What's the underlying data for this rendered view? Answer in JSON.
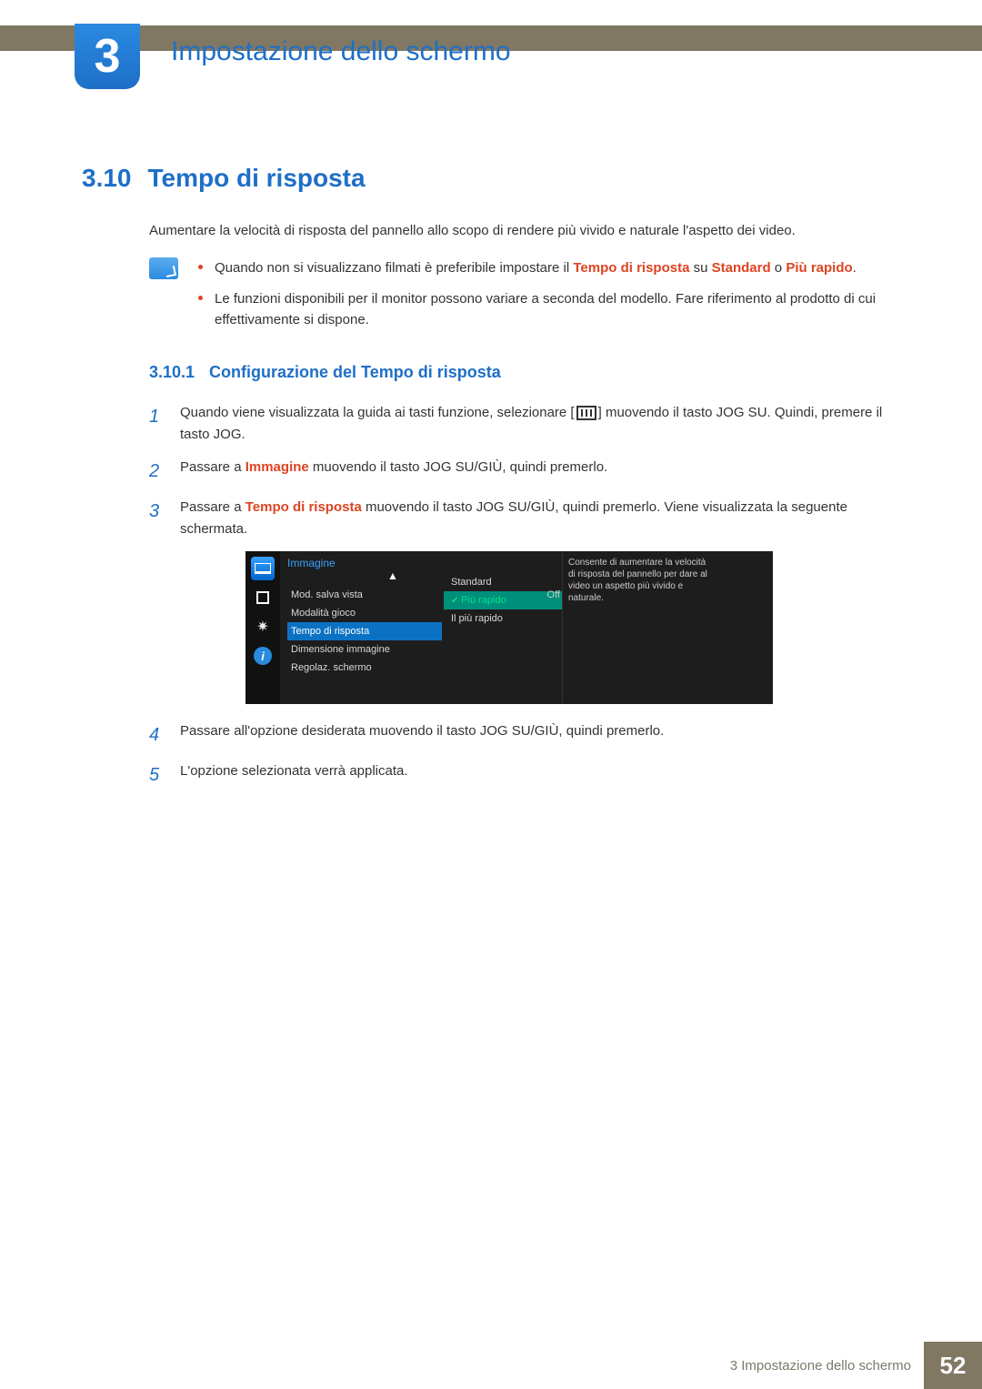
{
  "chapter": {
    "number": "3",
    "title": "Impostazione dello schermo"
  },
  "section": {
    "number": "3.10",
    "title": "Tempo di risposta"
  },
  "intro": "Aumentare la velocità di risposta del pannello allo scopo di rendere più vivido e naturale l'aspetto dei video.",
  "notes": {
    "items": [
      {
        "pre": "Quando non si visualizzano filmati è preferibile impostare il ",
        "b1": "Tempo di risposta",
        "mid": " su ",
        "b2": "Standard",
        "or": " o ",
        "b3": "Più rapido",
        "end": "."
      },
      "Le funzioni disponibili per il monitor possono variare a seconda del modello. Fare riferimento al prodotto di cui effettivamente si dispone."
    ]
  },
  "subsection": {
    "number": "3.10.1",
    "title": "Configurazione del Tempo di risposta"
  },
  "steps": [
    {
      "a": "Quando viene visualizzata la guida ai tasti funzione, selezionare [",
      "b": "] muovendo il tasto JOG SU. Quindi, premere il tasto JOG."
    },
    {
      "a": "Passare a ",
      "em": "Immagine",
      "b": " muovendo il tasto JOG SU/GIÙ, quindi premerlo."
    },
    {
      "a": "Passare a ",
      "em": "Tempo di risposta",
      "b": " muovendo il tasto JOG SU/GIÙ, quindi premerlo. Viene visualizzata la seguente schermata."
    },
    {
      "a": "Passare all'opzione desiderata muovendo il tasto JOG SU/GIÙ, quindi premerlo."
    },
    {
      "a": "L'opzione selezionata verrà applicata."
    }
  ],
  "step_numbers": [
    "1",
    "2",
    "3",
    "4",
    "5"
  ],
  "osd": {
    "header": "Immagine",
    "arrow_up": "▲",
    "items": {
      "mod_salva": {
        "label": "Mod. salva vista",
        "value": "Off"
      },
      "modalita_gioco": "Modalità gioco",
      "tempo_risposta": "Tempo di risposta",
      "dim_immagine": "Dimensione immagine",
      "regolaz": "Regolaz. schermo"
    },
    "options": {
      "standard": "Standard",
      "piu_rapido": "Più rapido",
      "il_piu_rapido": "Il più rapido"
    },
    "description": "Consente di aumentare la velocità di risposta del pannello per dare al video un aspetto più vivido e naturale."
  },
  "footer": {
    "title": "3 Impostazione dello schermo",
    "page": "52"
  }
}
